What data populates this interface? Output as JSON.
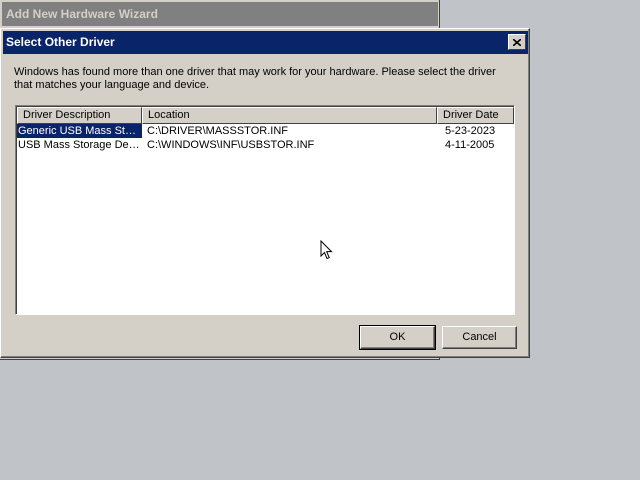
{
  "background_window": {
    "title": "Add New Hardware Wizard"
  },
  "dialog": {
    "title": "Select Other Driver",
    "close_icon": "close-icon",
    "message": "Windows has found more than one driver that may work for your hardware.  Please select the driver that matches your language and device.",
    "list": {
      "columns": [
        "Driver Description",
        "Location",
        "Driver Date"
      ],
      "rows": [
        {
          "description": "Generic USB Mass Storage Device",
          "location": "C:\\DRIVER\\MASSSTOR.INF",
          "date": "5-23-2023",
          "selected": true
        },
        {
          "description": "USB Mass Storage Device",
          "location": "C:\\WINDOWS\\INF\\USBSTOR.INF",
          "date": "4-11-2005",
          "selected": false
        }
      ]
    },
    "ok_label": "OK",
    "cancel_label": "Cancel"
  },
  "colors": {
    "desktop": "#c0c4c8",
    "active_title": "#0a246a",
    "inactive_title": "#808080",
    "face": "#d4d0c8",
    "selection": "#0a246a"
  }
}
